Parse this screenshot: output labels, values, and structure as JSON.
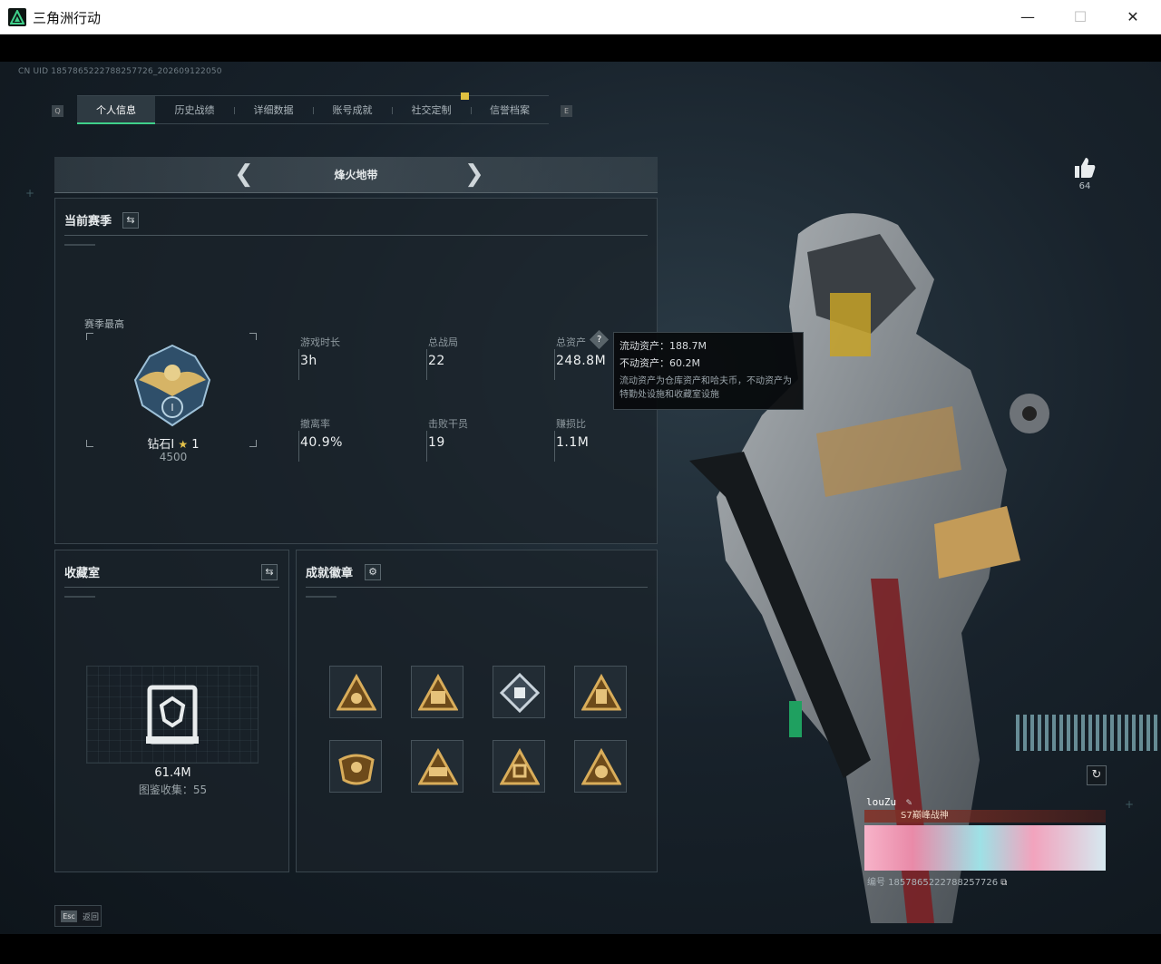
{
  "window": {
    "title": "三角洲行动",
    "controls": {
      "minimize": "—",
      "maximize": "☐",
      "close": "✕"
    }
  },
  "header": {
    "uid": "CN UID 1857865222788257726_202609122050",
    "ghost_title": ""
  },
  "tabs": {
    "left_key": "Q",
    "right_key": "E",
    "items": [
      {
        "label": "个人信息",
        "active": true
      },
      {
        "label": "历史战绩",
        "active": false
      },
      {
        "label": "详细数据",
        "active": false
      },
      {
        "label": "账号成就",
        "active": false
      },
      {
        "label": "社交定制",
        "active": false
      },
      {
        "label": "信誉档案",
        "active": false
      }
    ]
  },
  "mode_selector": {
    "current": "烽火地带",
    "prev_icon": "chevron-left-icon",
    "next_icon": "chevron-right-icon"
  },
  "season": {
    "title": "当前赛季",
    "best_label": "赛季最高",
    "rank_name": "钻石I",
    "rank_stars": "1",
    "rank_points": "4500",
    "stats": [
      {
        "label": "游戏时长",
        "value": "3h"
      },
      {
        "label": "总战局",
        "value": "22"
      },
      {
        "label": "总资产",
        "value": "248.8M"
      },
      {
        "label": "撤离率",
        "value": "40.9%"
      },
      {
        "label": "击败干员",
        "value": "19"
      },
      {
        "label": "赚损比",
        "value": "1.1M"
      }
    ]
  },
  "asset_tooltip": {
    "liquid": "流动资产：188.7M",
    "fixed": "不动资产：60.2M",
    "desc": "流动资产为仓库资产和哈夫币，不动资产为特勤处设施和收藏室设施"
  },
  "collection": {
    "title": "收藏室",
    "value": "61.4M",
    "count_label": "图鉴收集：55"
  },
  "achievements": {
    "title": "成就徽章"
  },
  "like": {
    "count": "64"
  },
  "player_card": {
    "name": "louZu",
    "title": "S7巅峰战神",
    "id": "编号 1857865222788257726"
  },
  "footer": {
    "esc_key": "Esc",
    "esc_label": "返回"
  },
  "colors": {
    "accent": "#3fd08a",
    "gold": "#c9a45a",
    "panel": "#1a2229"
  }
}
